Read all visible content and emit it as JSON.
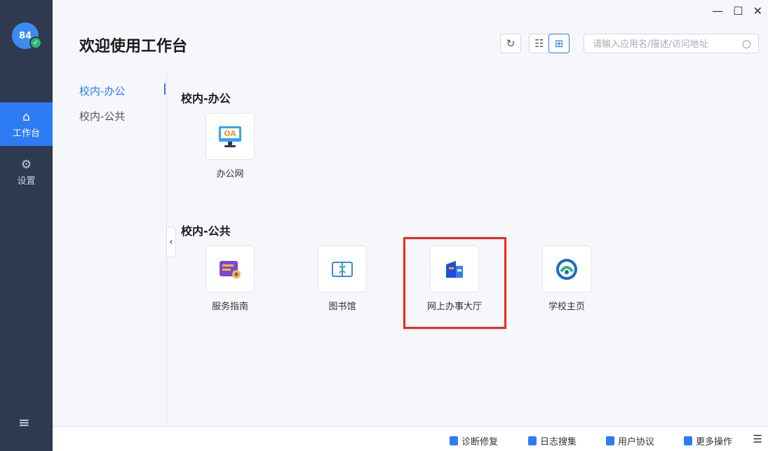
{
  "window": {
    "minimize": "—",
    "maximize": "☐",
    "close": "✕"
  },
  "user": {
    "avatar_text": "84",
    "status": "✓"
  },
  "rail": {
    "items": [
      {
        "icon": "⌂",
        "label": "工作台",
        "active": true
      },
      {
        "icon": "⚙",
        "label": "设置",
        "active": false
      }
    ],
    "menu_icon": "≡"
  },
  "header": {
    "title": "欢迎使用工作台",
    "refresh_icon": "↻",
    "list_view_icon": "☷",
    "grid_view_icon": "⊞",
    "search_placeholder": "请输入应用名/描述/访问地址",
    "search_icon": "○"
  },
  "categories": [
    {
      "label": "校内-办公",
      "active": true
    },
    {
      "label": "校内-公共",
      "active": false
    }
  ],
  "sections": [
    {
      "title": "校内-办公",
      "apps": [
        {
          "label": "办公网",
          "icon_text": "OA"
        }
      ]
    },
    {
      "title": "校内-公共",
      "apps": [
        {
          "label": "服务指南"
        },
        {
          "label": "图书馆"
        },
        {
          "label": "网上办事大厅"
        },
        {
          "label": "学校主页"
        }
      ]
    }
  ],
  "footer": {
    "items": [
      "诊断修复",
      "日志搜集",
      "用户协议",
      "更多操作"
    ],
    "menu_icon": "☰"
  },
  "colors": {
    "accent": "#2d7cf6",
    "rail": "#2f3a50",
    "highlight": "#f0291a"
  }
}
